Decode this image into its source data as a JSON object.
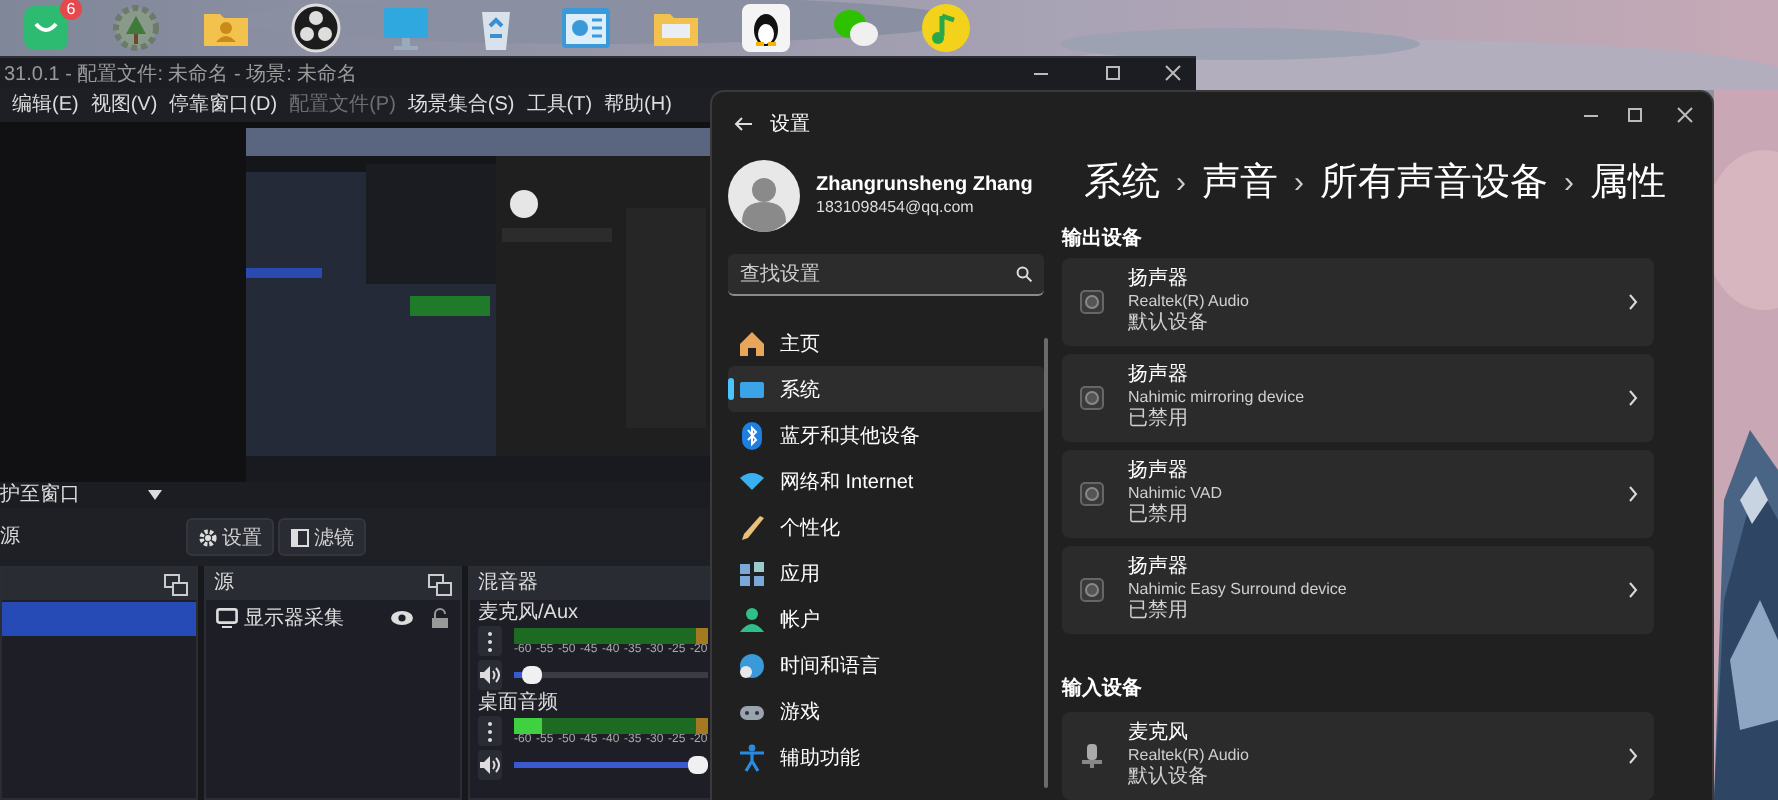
{
  "desktop_icons": [
    {
      "kind": "store",
      "badge": "6"
    },
    {
      "kind": "gear"
    },
    {
      "kind": "contacts-folder"
    },
    {
      "kind": "recorder"
    },
    {
      "kind": "monitor"
    },
    {
      "kind": "recycle-bin"
    },
    {
      "kind": "chart"
    },
    {
      "kind": "folder"
    },
    {
      "kind": "penguin"
    },
    {
      "kind": "chat"
    },
    {
      "kind": "music"
    }
  ],
  "obs": {
    "title": "31.0.1 - 配置文件: 未命名 - 场景: 未命名",
    "menu": [
      {
        "label": "编辑(E)",
        "disabled": false
      },
      {
        "label": "视图(V)",
        "disabled": false
      },
      {
        "label": "停靠窗口(D)",
        "disabled": false
      },
      {
        "label": "配置文件(P)",
        "disabled": true
      },
      {
        "label": "场景集合(S)",
        "disabled": false
      },
      {
        "label": "工具(T)",
        "disabled": false
      },
      {
        "label": "帮助(H)",
        "disabled": false
      }
    ],
    "zoom_bar": {
      "label": "护至窗口"
    },
    "toolbar": {
      "label": "源",
      "buttons": [
        {
          "kind": "settings",
          "label": "设置"
        },
        {
          "kind": "filters",
          "label": "滤镜"
        }
      ]
    },
    "scenes": {
      "items": [
        {
          "selected": true
        }
      ]
    },
    "sources": {
      "title": "源",
      "items": [
        {
          "name": "显示器采集",
          "visible": true,
          "locked": false
        }
      ]
    },
    "mixer": {
      "title": "混音器",
      "channels": [
        {
          "name": "麦克风/Aux",
          "meter": {
            "level": 0
          },
          "fader": {
            "level": 0.05
          },
          "ticks": [
            "-60",
            "-55",
            "-50",
            "-45",
            "-40",
            "-35",
            "-30",
            "-25",
            "-20"
          ]
        },
        {
          "name": "桌面音频",
          "meter": {
            "level": 0.14
          },
          "fader": {
            "level": 1
          },
          "ticks": [
            "-60",
            "-55",
            "-50",
            "-45",
            "-40",
            "-35",
            "-30",
            "-25",
            "-20"
          ]
        }
      ]
    }
  },
  "settings": {
    "title": "设置",
    "user": {
      "name": "Zhangrunsheng Zhang",
      "email": "1831098454@qq.com"
    },
    "search": {
      "placeholder": "查找设置"
    },
    "nav": [
      {
        "label": "主页",
        "kind": "home",
        "selected": false
      },
      {
        "label": "系统",
        "kind": "system",
        "selected": true
      },
      {
        "label": "蓝牙和其他设备",
        "kind": "bluetooth",
        "selected": false
      },
      {
        "label": "网络和 Internet",
        "kind": "network",
        "selected": false
      },
      {
        "label": "个性化",
        "kind": "personalization",
        "selected": false
      },
      {
        "label": "应用",
        "kind": "apps",
        "selected": false
      },
      {
        "label": "帐户",
        "kind": "accounts",
        "selected": false
      },
      {
        "label": "时间和语言",
        "kind": "time",
        "selected": false
      },
      {
        "label": "游戏",
        "kind": "gaming",
        "selected": false
      },
      {
        "label": "辅助功能",
        "kind": "accessibility",
        "selected": false
      }
    ],
    "breadcrumb": [
      {
        "kind": "crumb",
        "text": "系统"
      },
      {
        "kind": "separator",
        "text": "›"
      },
      {
        "kind": "crumb",
        "text": "声音"
      },
      {
        "kind": "separator",
        "text": "›"
      },
      {
        "kind": "crumb",
        "text": "所有声音设备"
      },
      {
        "kind": "separator",
        "text": "›"
      },
      {
        "kind": "crumb",
        "text": "属性"
      }
    ],
    "sections": [
      {
        "title": "输出设备",
        "devices": [
          {
            "kind": "speaker",
            "name": "扬声器",
            "driver": "Realtek(R) Audio",
            "status": "默认设备"
          },
          {
            "kind": "speaker",
            "name": "扬声器",
            "driver": "Nahimic mirroring device",
            "status": "已禁用"
          },
          {
            "kind": "speaker",
            "name": "扬声器",
            "driver": "Nahimic VAD",
            "status": "已禁用"
          },
          {
            "kind": "speaker",
            "name": "扬声器",
            "driver": "Nahimic Easy Surround device",
            "status": "已禁用"
          }
        ]
      },
      {
        "title": "输入设备",
        "devices": [
          {
            "kind": "microphone",
            "name": "麦克风",
            "driver": "Realtek(R) Audio",
            "status": "默认设备"
          }
        ]
      }
    ]
  }
}
